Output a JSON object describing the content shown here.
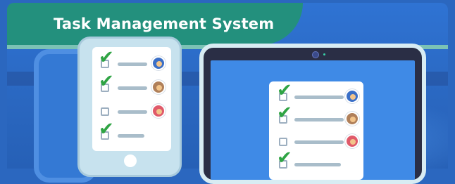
{
  "banner": {
    "title": "Task Management System"
  },
  "colors": {
    "banner": "#23907d",
    "background": "#2b67bf",
    "check": "#2fa444",
    "tablet_screen": "#3f8ae6"
  },
  "phone_tasks": [
    {
      "done": true,
      "avatar": "#3a6fc7"
    },
    {
      "done": true,
      "avatar": "#b0805a"
    },
    {
      "done": false,
      "avatar": "#e05a6a"
    },
    {
      "done": true,
      "avatar": null
    }
  ],
  "tablet_tasks": [
    {
      "done": true,
      "avatar": "#3a6fc7"
    },
    {
      "done": true,
      "avatar": "#b0805a"
    },
    {
      "done": false,
      "avatar": "#e05a6a"
    },
    {
      "done": true,
      "avatar": null
    }
  ]
}
